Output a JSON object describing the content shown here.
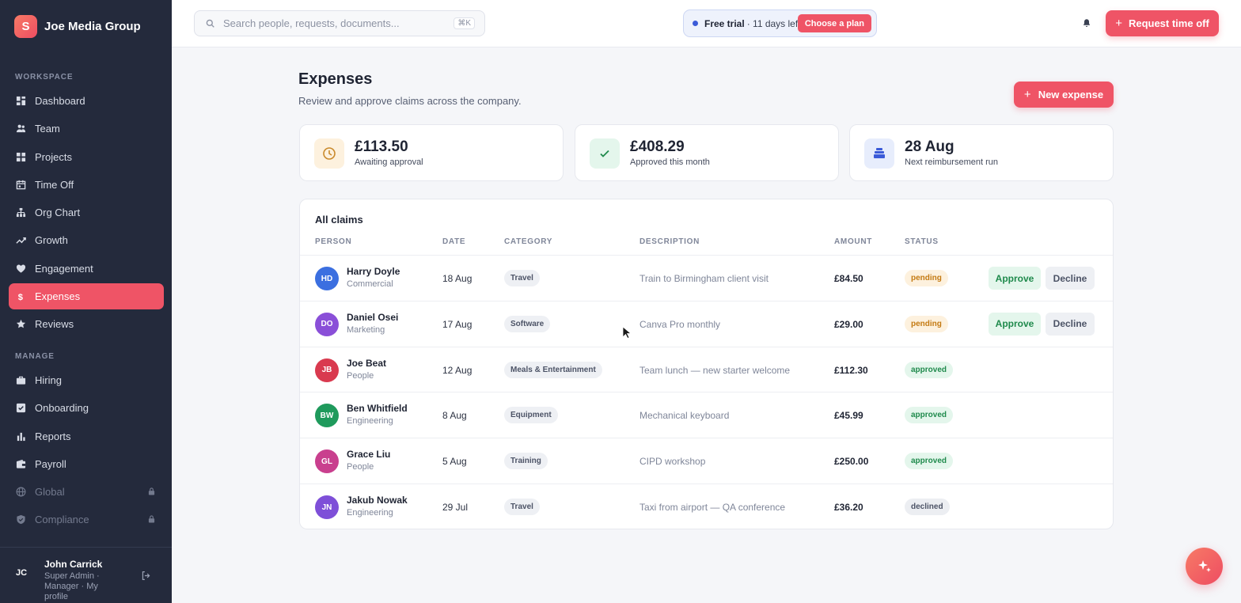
{
  "brand": {
    "logo_letter": "S",
    "name": "Joe Media Group"
  },
  "sidebar": {
    "workspace_label": "WORKSPACE",
    "manage_label": "MANAGE",
    "workspace_items": [
      {
        "label": "Dashboard",
        "icon": "dashboard-icon"
      },
      {
        "label": "Team",
        "icon": "team-icon"
      },
      {
        "label": "Projects",
        "icon": "projects-icon"
      },
      {
        "label": "Time Off",
        "icon": "calendar-icon"
      },
      {
        "label": "Org Chart",
        "icon": "org-chart-icon"
      },
      {
        "label": "Growth",
        "icon": "growth-icon"
      },
      {
        "label": "Engagement",
        "icon": "heart-icon"
      },
      {
        "label": "Expenses",
        "icon": "dollar-icon",
        "active": true
      },
      {
        "label": "Reviews",
        "icon": "star-icon"
      }
    ],
    "manage_items": [
      {
        "label": "Hiring",
        "icon": "briefcase-icon"
      },
      {
        "label": "Onboarding",
        "icon": "checkbox-icon"
      },
      {
        "label": "Reports",
        "icon": "bar-chart-icon"
      },
      {
        "label": "Payroll",
        "icon": "wallet-icon"
      },
      {
        "label": "Global",
        "icon": "globe-icon",
        "locked": true
      },
      {
        "label": "Compliance",
        "icon": "shield-icon",
        "locked": true
      }
    ],
    "user": {
      "initials": "JC",
      "name": "John Carrick",
      "role": "Super Admin · Manager · My profile"
    }
  },
  "topbar": {
    "search_placeholder": "Search people, requests, documents...",
    "search_shortcut": "⌘K",
    "trial_strong": "Free trial",
    "trial_rest": "· 11 days left",
    "plan_button": "Choose a plan",
    "request_button": "Request time off"
  },
  "page": {
    "title": "Expenses",
    "subtitle": "Review and approve claims across the company.",
    "new_button": "New expense"
  },
  "stats": [
    {
      "value": "£113.50",
      "label": "Awaiting approval",
      "icon": "clock-icon",
      "bg": "#fdf1de",
      "fg": "#c9892b"
    },
    {
      "value": "£408.29",
      "label": "Approved this month",
      "icon": "check-icon",
      "bg": "#e4f6ec",
      "fg": "#1f8a4c"
    },
    {
      "value": "28 Aug",
      "label": "Next reimbursement run",
      "icon": "stack-icon",
      "bg": "#e7edfc",
      "fg": "#3b5bd8"
    }
  ],
  "claims": {
    "title": "All claims",
    "headers": [
      "PERSON",
      "DATE",
      "CATEGORY",
      "DESCRIPTION",
      "AMOUNT",
      "STATUS"
    ],
    "approve_label": "Approve",
    "decline_label": "Decline",
    "rows": [
      {
        "initials": "HD",
        "color": "#3b6fe0",
        "name": "Harry Doyle",
        "dept": "Commercial",
        "date": "18 Aug",
        "category": "Travel",
        "description": "Train to Birmingham client visit",
        "amount": "£84.50",
        "status": "pending"
      },
      {
        "initials": "DO",
        "color": "#8a4fd8",
        "name": "Daniel Osei",
        "dept": "Marketing",
        "date": "17 Aug",
        "category": "Software",
        "description": "Canva Pro monthly",
        "amount": "£29.00",
        "status": "pending"
      },
      {
        "initials": "JB",
        "color": "#d93a4f",
        "name": "Joe Beat",
        "dept": "People",
        "date": "12 Aug",
        "category": "Meals & Entertainment",
        "description": "Team lunch — new starter welcome",
        "amount": "£112.30",
        "status": "approved"
      },
      {
        "initials": "BW",
        "color": "#1f9a5c",
        "name": "Ben Whitfield",
        "dept": "Engineering",
        "date": "8 Aug",
        "category": "Equipment",
        "description": "Mechanical keyboard",
        "amount": "£45.99",
        "status": "approved"
      },
      {
        "initials": "GL",
        "color": "#c93f8e",
        "name": "Grace Liu",
        "dept": "People",
        "date": "5 Aug",
        "category": "Training",
        "description": "CIPD workshop",
        "amount": "£250.00",
        "status": "approved"
      },
      {
        "initials": "JN",
        "color": "#7e4fd8",
        "name": "Jakub Nowak",
        "dept": "Engineering",
        "date": "29 Jul",
        "category": "Travel",
        "description": "Taxi from airport — QA conference",
        "amount": "£36.20",
        "status": "declined"
      }
    ]
  },
  "colors": {
    "accent": "#ef5466",
    "sidebar_bg": "#242a3c",
    "page_bg": "#f5f6f9"
  }
}
